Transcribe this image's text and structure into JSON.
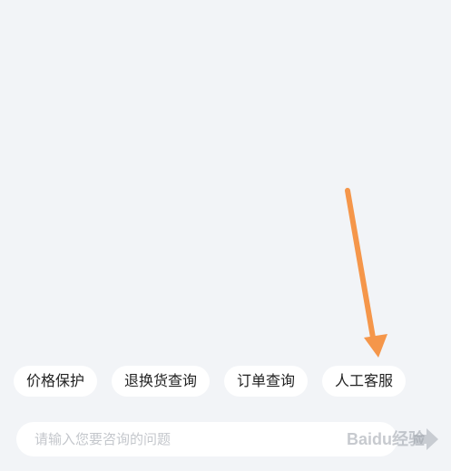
{
  "quick_replies": [
    {
      "label": "价格保护"
    },
    {
      "label": "退换货查询"
    },
    {
      "label": "订单查询"
    },
    {
      "label": "人工客服"
    }
  ],
  "input": {
    "placeholder": "请输入您要咨询的问题",
    "value": ""
  },
  "send": {
    "icon": "send-arrow-icon",
    "color": "#c8ccd2"
  },
  "annotation": {
    "icon": "orange-arrow-icon",
    "color": "#f5964a"
  },
  "watermark": {
    "text": "Baidu经验"
  },
  "colors": {
    "background": "#f2f4f7",
    "chip_background": "#ffffff"
  }
}
